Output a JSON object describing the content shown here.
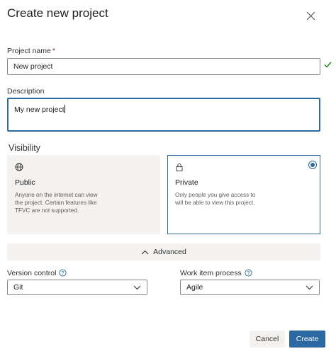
{
  "dialog": {
    "title": "Create new project"
  },
  "project_name": {
    "label": "Project name",
    "required_mark": "*",
    "value": "New project"
  },
  "description": {
    "label": "Description",
    "value": "My new project"
  },
  "visibility": {
    "heading": "Visibility",
    "options": [
      {
        "title": "Public",
        "icon": "globe-icon",
        "description": "Anyone on the internet can view the project. Certain features like TFVC are not supported.",
        "selected": false
      },
      {
        "title": "Private",
        "icon": "lock-icon",
        "description": "Only people you give access to will be able to view this project.",
        "selected": true
      }
    ]
  },
  "advanced": {
    "label": "Advanced",
    "expanded": true
  },
  "version_control": {
    "label": "Version control",
    "value": "Git"
  },
  "work_item_process": {
    "label": "Work item process",
    "value": "Agile"
  },
  "footer": {
    "cancel_label": "Cancel",
    "create_label": "Create"
  },
  "colors": {
    "accent": "#2c69a3",
    "valid_check": "#107c10",
    "required": "#a4262c",
    "card_bg": "#f3f2f1"
  }
}
